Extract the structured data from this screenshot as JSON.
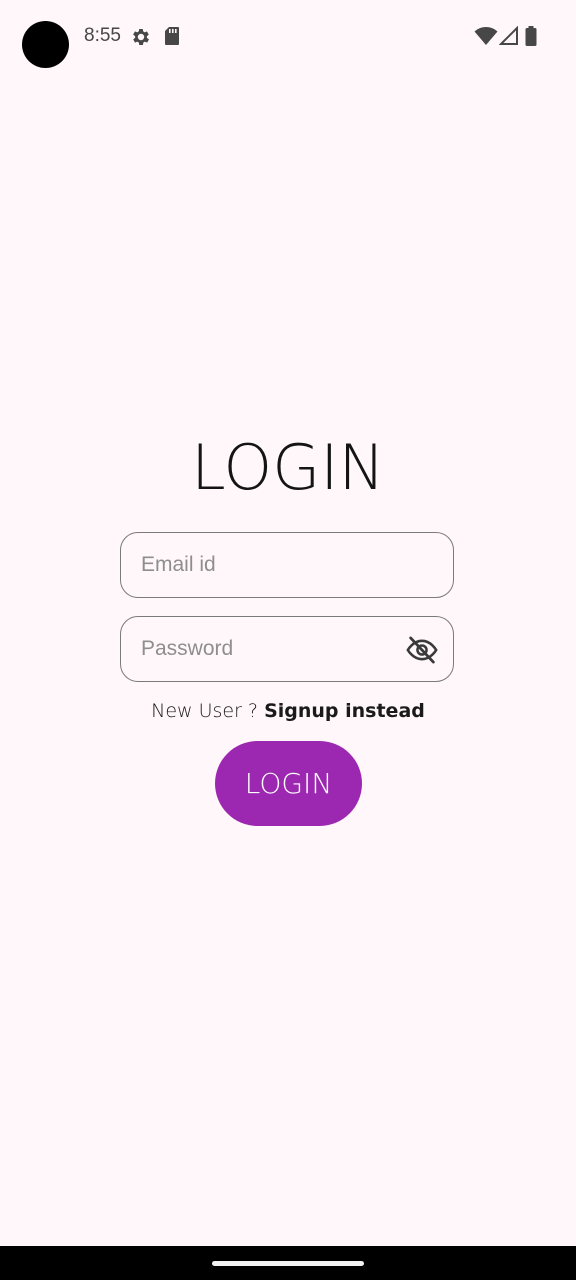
{
  "status_bar": {
    "time": "8:55",
    "icons": [
      "gear-icon",
      "sd-card-icon",
      "wifi-icon",
      "signal-icon",
      "battery-icon"
    ]
  },
  "login_form": {
    "title": "LOGIN",
    "email": {
      "placeholder": "Email id",
      "value": ""
    },
    "password": {
      "placeholder": "Password",
      "value": "",
      "toggle_icon": "eye-off-icon"
    },
    "signup_prompt": "New User ? ",
    "signup_link": "Signup instead",
    "submit_label": "LOGIN"
  },
  "colors": {
    "background": "#fff7fa",
    "primary": "#9c27b0",
    "border": "#7a7a7a"
  }
}
